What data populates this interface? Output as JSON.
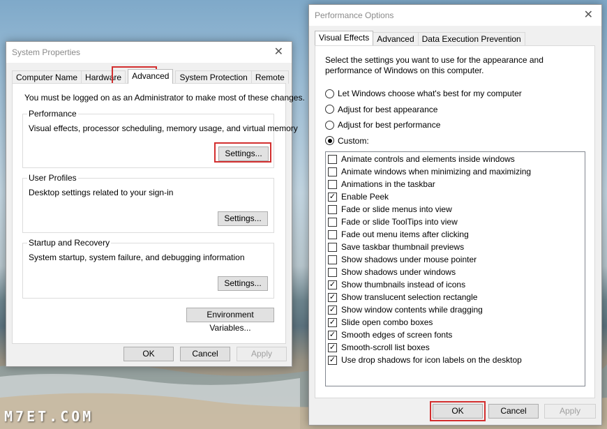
{
  "watermark": "M7ET.COM",
  "system_properties": {
    "title": "System Properties",
    "tabs": [
      "Computer Name",
      "Hardware",
      "Advanced",
      "System Protection",
      "Remote"
    ],
    "notice": "You must be logged on as an Administrator to make most of these changes.",
    "performance": {
      "label": "Performance",
      "desc": "Visual effects, processor scheduling, memory usage, and virtual memory",
      "button": "Settings..."
    },
    "user_profiles": {
      "label": "User Profiles",
      "desc": "Desktop settings related to your sign-in",
      "button": "Settings..."
    },
    "startup": {
      "label": "Startup and Recovery",
      "desc": "System startup, system failure, and debugging information",
      "button": "Settings..."
    },
    "env_button": "Environment Variables...",
    "ok": "OK",
    "cancel": "Cancel",
    "apply": "Apply"
  },
  "performance_options": {
    "title": "Performance Options",
    "tabs": [
      "Visual Effects",
      "Advanced",
      "Data Execution Prevention"
    ],
    "intro_line1": "Select the settings you want to use for the appearance and",
    "intro_line2": "performance of Windows on this computer.",
    "radios": [
      {
        "label": "Let Windows choose what's best for my computer",
        "selected": false
      },
      {
        "label": "Adjust for best appearance",
        "selected": false
      },
      {
        "label": "Adjust for best performance",
        "selected": false
      },
      {
        "label": "Custom:",
        "selected": true
      }
    ],
    "effects": [
      {
        "label": "Animate controls and elements inside windows",
        "checked": false
      },
      {
        "label": "Animate windows when minimizing and maximizing",
        "checked": false
      },
      {
        "label": "Animations in the taskbar",
        "checked": false
      },
      {
        "label": "Enable Peek",
        "checked": true
      },
      {
        "label": "Fade or slide menus into view",
        "checked": false
      },
      {
        "label": "Fade or slide ToolTips into view",
        "checked": false
      },
      {
        "label": "Fade out menu items after clicking",
        "checked": false
      },
      {
        "label": "Save taskbar thumbnail previews",
        "checked": false
      },
      {
        "label": "Show shadows under mouse pointer",
        "checked": false
      },
      {
        "label": "Show shadows under windows",
        "checked": false
      },
      {
        "label": "Show thumbnails instead of icons",
        "checked": true
      },
      {
        "label": "Show translucent selection rectangle",
        "checked": true
      },
      {
        "label": "Show window contents while dragging",
        "checked": true
      },
      {
        "label": "Slide open combo boxes",
        "checked": true
      },
      {
        "label": "Smooth edges of screen fonts",
        "checked": true
      },
      {
        "label": "Smooth-scroll list boxes",
        "checked": true
      },
      {
        "label": "Use drop shadows for icon labels on the desktop",
        "checked": true
      }
    ],
    "ok": "OK",
    "cancel": "Cancel",
    "apply": "Apply"
  },
  "colors": {
    "highlight": "#d32f2f"
  }
}
